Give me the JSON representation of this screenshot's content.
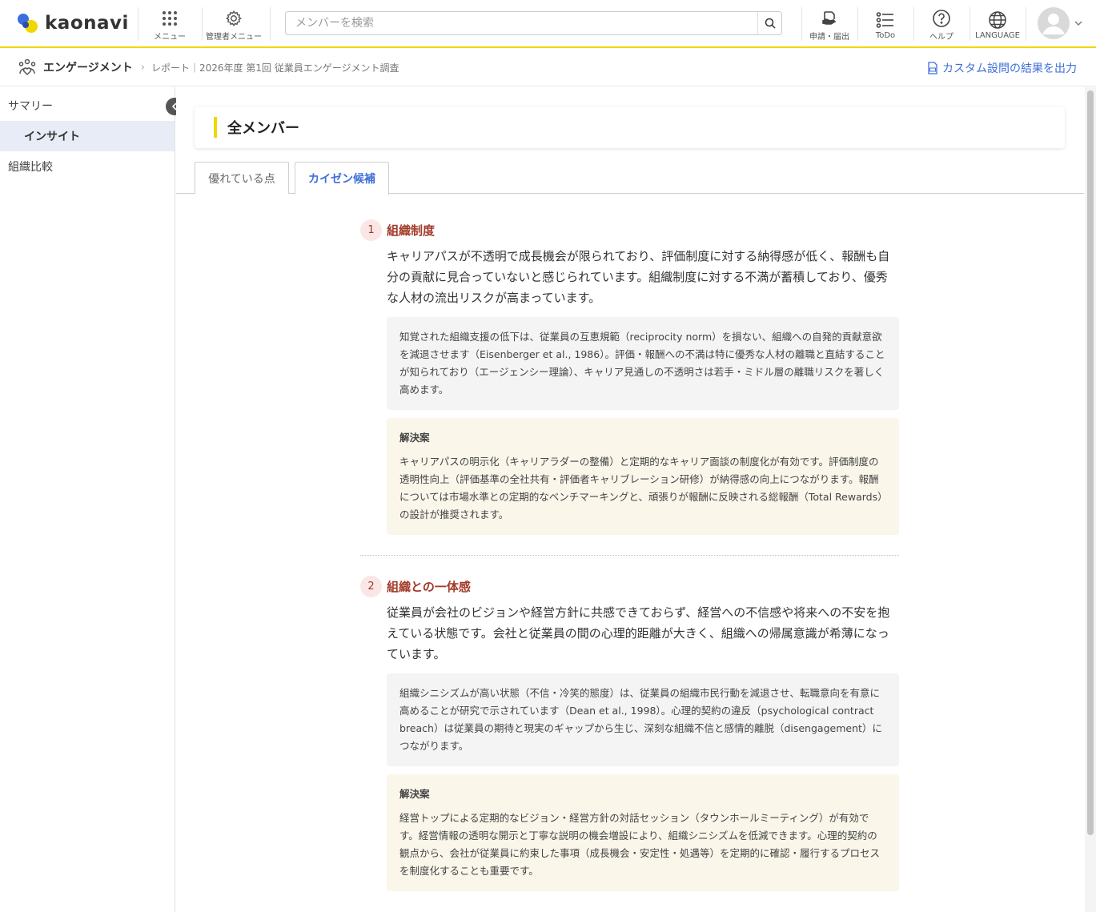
{
  "header": {
    "logo_text": "kaonavi",
    "menu_label": "メニュー",
    "admin_menu_label": "管理者メニュー",
    "search_placeholder": "メンバーを検索",
    "apply_label": "申請・届出",
    "todo_label": "ToDo",
    "help_label": "ヘルプ",
    "language_label": "LANGUAGE"
  },
  "breadcrumb": {
    "section": "エンゲージメント",
    "page": "レポート｜2026年度 第1回 従業員エンゲージメント調査",
    "export_label": "カスタム設問の結果を出力"
  },
  "sidebar": {
    "items": [
      {
        "label": "サマリー"
      },
      {
        "label": "インサイト"
      },
      {
        "label": "組織比較"
      }
    ]
  },
  "main": {
    "title": "全メンバー",
    "tabs": [
      {
        "label": "優れている点"
      },
      {
        "label": "カイゼン候補"
      }
    ],
    "items": [
      {
        "number": "1",
        "title": "組織制度",
        "lead": "キャリアパスが不透明で成長機会が限られており、評価制度に対する納得感が低く、報酬も自分の貢献に見合っていないと感じられています。組織制度に対する不満が蓄積しており、優秀な人材の流出リスクが高まっています。",
        "note": "知覚された組織支援の低下は、従業員の互恵規範（reciprocity norm）を損ない、組織への自発的貢献意欲を減退させます（Eisenberger et al., 1986）。評価・報酬への不満は特に優秀な人材の離職と直結することが知られており（エージェンシー理論）、キャリア見通しの不透明さは若手・ミドル層の離職リスクを著しく高めます。",
        "solution_heading": "解決案",
        "solution": "キャリアパスの明示化（キャリアラダーの整備）と定期的なキャリア面談の制度化が有効です。評価制度の透明性向上（評価基準の全社共有・評価者キャリブレーション研修）が納得感の向上につながります。報酬については市場水準との定期的なベンチマーキングと、頑張りが報酬に反映される総報酬（Total Rewards）の設計が推奨されます。"
      },
      {
        "number": "2",
        "title": "組織との一体感",
        "lead": "従業員が会社のビジョンや経営方針に共感できておらず、経営への不信感や将来への不安を抱えている状態です。会社と従業員の間の心理的距離が大きく、組織への帰属意識が希薄になっています。",
        "note": "組織シニシズムが高い状態（不信・冷笑的態度）は、従業員の組織市民行動を減退させ、転職意向を有意に高めることが研究で示されています（Dean et al., 1998）。心理的契約の違反（psychological contract breach）は従業員の期待と現実のギャップから生じ、深刻な組織不信と感情的離脱（disengagement）につながります。",
        "solution_heading": "解決案",
        "solution": "経営トップによる定期的なビジョン・経営方針の対話セッション（タウンホールミーティング）が有効です。経営情報の透明な開示と丁寧な説明の機会増設により、組織シニシズムを低減できます。心理的契約の観点から、会社が従業員に約束した事項（成長機会・安定性・処遇等）を定期的に確認・履行するプロセスを制度化することも重要です。"
      }
    ]
  },
  "colors": {
    "accent_yellow": "#f2d600",
    "link_blue": "#3f6fd8",
    "item_red": "#a23b2a"
  }
}
